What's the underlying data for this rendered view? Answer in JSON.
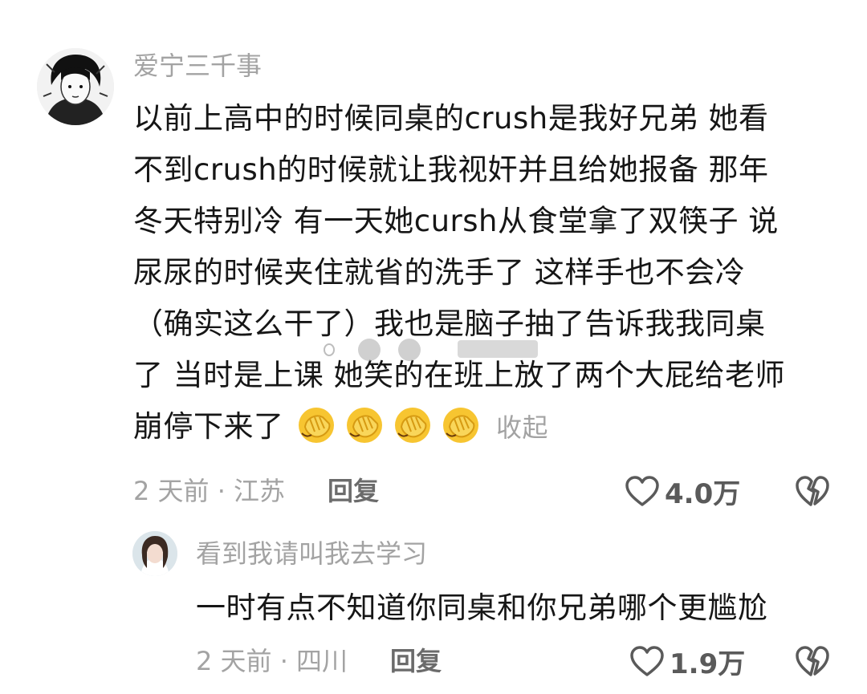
{
  "comments": [
    {
      "username": "爱宁三千事",
      "lines": [
        "以前上高中的时候同桌的crush是我好兄弟 她看",
        "不到crush的时候就让我视奸并且给她报备 那年",
        "冬天特别冷 有一天她cursh从食堂拿了双筷子 说",
        "尿尿的时候夹住就省的洗手了 这样手也不会冷",
        "（确实这么干了）我也是脑子抽了告诉我我同桌",
        "了 当时是上课 她笑的在班上放了两个大屁给老师",
        "崩停下来了"
      ],
      "emoji": "facepalm-emoji",
      "collapse_label": "收起",
      "time_location": "2 天前 · 江苏",
      "reply_label": "回复",
      "like_count": "4.0万"
    },
    {
      "username": "看到我请叫我去学习",
      "text": "一时有点不知道你同桌和你兄弟哪个更尴尬",
      "time_location": "2 天前 · 四川",
      "reply_label": "回复",
      "like_count": "1.9万"
    }
  ],
  "icons": {
    "like": "heart-outline-icon",
    "dislike": "broken-heart-icon"
  },
  "colors": {
    "text": "#161616",
    "muted": "#a3a3a3",
    "action": "#6b6b6b",
    "emoji": "#f7c531"
  }
}
